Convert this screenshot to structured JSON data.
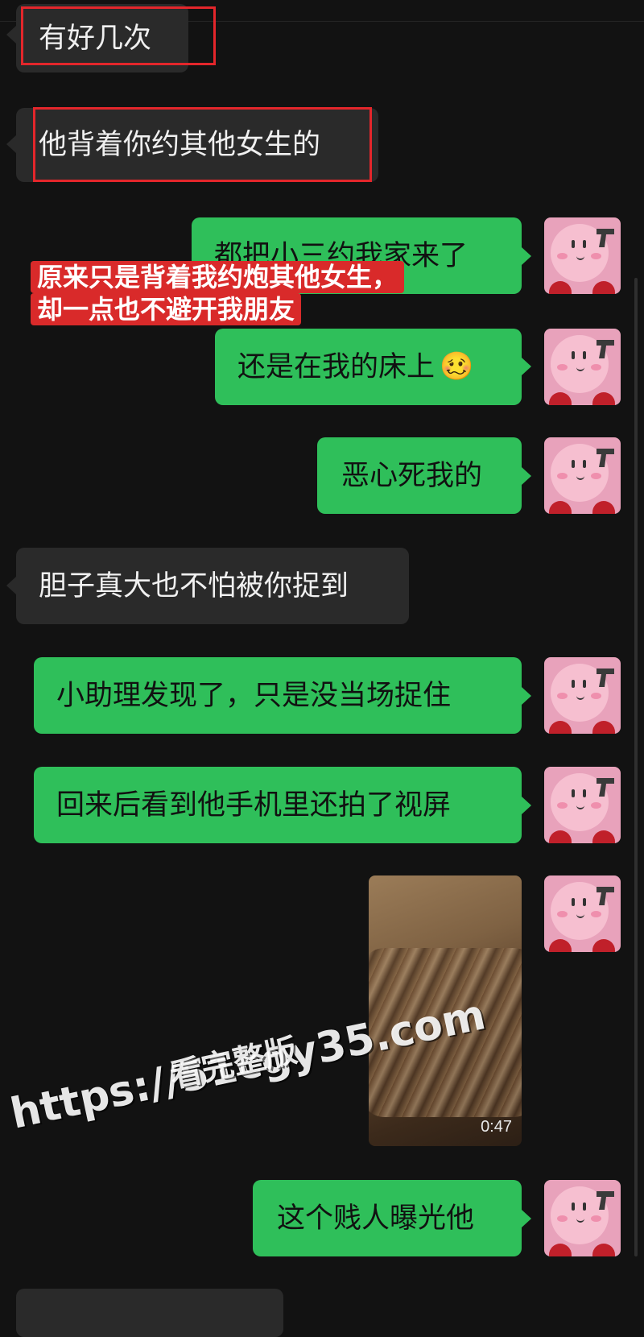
{
  "messages": [
    {
      "side": "received",
      "text": "有好几次"
    },
    {
      "side": "received",
      "text": "他背着你约其他女生的"
    },
    {
      "side": "sent",
      "text": "都把小三约我家来了"
    },
    {
      "side": "sent",
      "text": "还是在我的床上",
      "emoji": "🥴"
    },
    {
      "side": "sent",
      "text": "恶心死我的"
    },
    {
      "side": "received",
      "text": "胆子真大也不怕被你捉到"
    },
    {
      "side": "sent",
      "text": "小助理发现了，只是没当场捉住"
    },
    {
      "side": "sent",
      "text": "回来后看到他手机里还拍了视屏"
    },
    {
      "side": "sent",
      "type": "video",
      "duration": "0:47"
    },
    {
      "side": "sent",
      "text": "这个贱人曝光他"
    }
  ],
  "overlay_caption": {
    "line1": "原来只是背着我约炮其他女生，",
    "line2": "却一点也不避开我朋友"
  },
  "watermark": {
    "url": "https://51cgy35.com",
    "subtitle": "看完整版"
  },
  "icons": {
    "avatar": "pink-plush-avatar-icon",
    "video": "video-thumbnail"
  },
  "colors": {
    "background": "#121212",
    "sent_bubble": "#2fbf5a",
    "received_bubble": "#2a2a2a",
    "highlight_red": "#e3262b"
  }
}
